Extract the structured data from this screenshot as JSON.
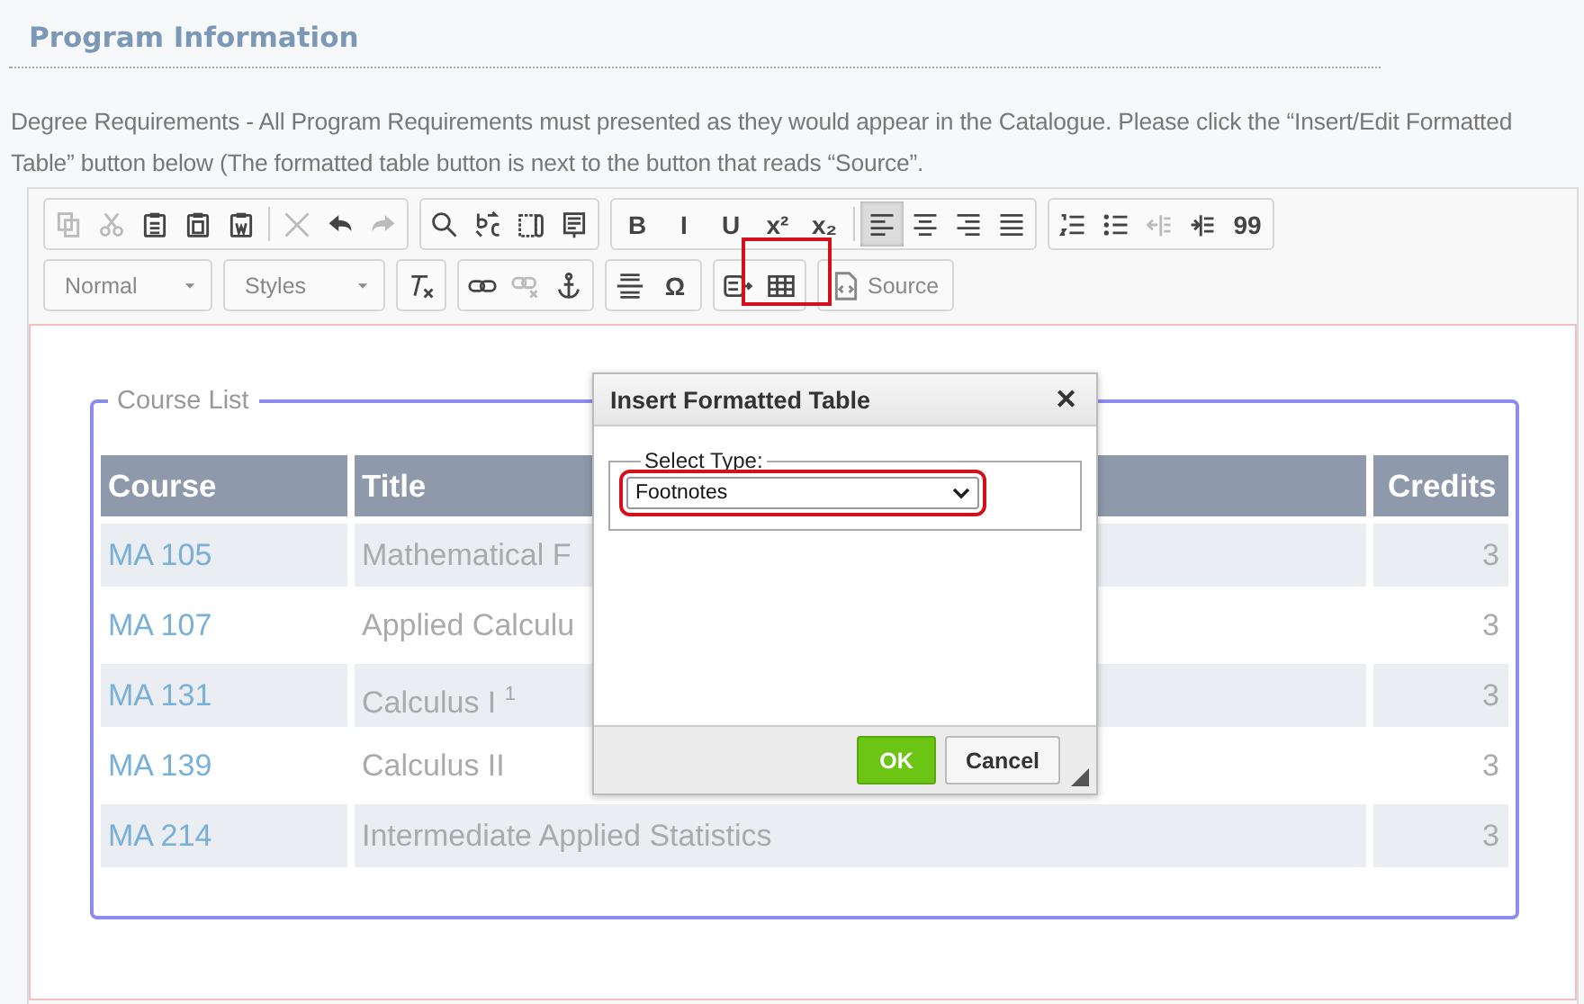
{
  "section_title": "Program Information",
  "instructions": "Degree Requirements - All Program Requirements must presented as they would appear in the Catalogue. Please click the “Insert/Edit Formatted Table” button below (The formatted table button is next to the button that reads “Source”.",
  "toolbar": {
    "rows": [
      [
        {
          "items": [
            {
              "kind": "icon",
              "disabled": true,
              "active": false
            },
            {
              "kind": "icon",
              "disabled": true,
              "active": false
            },
            {
              "kind": "icon",
              "disabled": false,
              "active": false
            },
            {
              "kind": "icon",
              "disabled": false,
              "active": false
            },
            {
              "kind": "icon",
              "disabled": false,
              "active": false
            },
            {
              "kind": "separator"
            },
            {
              "kind": "icon",
              "disabled": true,
              "active": false
            },
            {
              "kind": "icon",
              "disabled": false,
              "active": false
            },
            {
              "kind": "icon",
              "disabled": true,
              "active": false
            }
          ]
        },
        {
          "items": [
            {
              "kind": "icon",
              "disabled": false,
              "active": false
            },
            {
              "kind": "icon",
              "disabled": false,
              "active": false
            },
            {
              "kind": "icon",
              "disabled": false,
              "active": false
            },
            {
              "kind": "icon",
              "disabled": false,
              "active": false
            }
          ]
        },
        {
          "items": [
            {
              "kind": "glyph",
              "text": "B",
              "disabled": false,
              "active": false
            },
            {
              "kind": "glyph",
              "text": "I",
              "disabled": false,
              "active": false
            },
            {
              "kind": "glyph",
              "text": "U",
              "disabled": false,
              "active": false
            },
            {
              "kind": "glyph",
              "text": "x²",
              "disabled": false,
              "active": false
            },
            {
              "kind": "glyph",
              "text": "x₂",
              "disabled": false,
              "active": false
            },
            {
              "kind": "separator"
            },
            {
              "kind": "icon",
              "disabled": false,
              "active": true
            },
            {
              "kind": "icon",
              "disabled": false,
              "active": false
            },
            {
              "kind": "icon",
              "disabled": false,
              "active": false
            },
            {
              "kind": "icon",
              "disabled": false,
              "active": false
            }
          ]
        },
        {
          "items": [
            {
              "kind": "icon",
              "disabled": false,
              "active": false
            },
            {
              "kind": "icon",
              "disabled": false,
              "active": false
            },
            {
              "kind": "icon",
              "disabled": true,
              "active": false
            },
            {
              "kind": "icon",
              "disabled": false,
              "active": false
            },
            {
              "kind": "glyph",
              "text": "99",
              "disabled": false,
              "active": false
            }
          ]
        }
      ],
      [
        {
          "items": [
            {
              "kind": "dropdown",
              "text": "Normal"
            }
          ]
        },
        {
          "items": [
            {
              "kind": "dropdown",
              "text": "Styles"
            }
          ]
        },
        {
          "items": [
            {
              "kind": "icon",
              "disabled": false,
              "active": false
            }
          ]
        },
        {
          "items": [
            {
              "kind": "icon",
              "disabled": false,
              "active": false
            },
            {
              "kind": "icon",
              "disabled": true,
              "active": false
            },
            {
              "kind": "icon",
              "disabled": false,
              "active": false
            }
          ]
        },
        {
          "items": [
            {
              "kind": "icon",
              "disabled": false,
              "active": false
            },
            {
              "kind": "glyph",
              "text": "Ω",
              "disabled": false,
              "active": false
            }
          ]
        },
        {
          "items": [
            {
              "kind": "icon",
              "disabled": false,
              "active": false
            },
            {
              "kind": "icon",
              "disabled": false,
              "active": false,
              "highlighted": true
            }
          ]
        },
        {
          "items": [
            {
              "kind": "labeled",
              "text": "Source",
              "disabled": false,
              "active": false
            }
          ]
        }
      ]
    ]
  },
  "course_list": {
    "legend": "Course List",
    "columns": [
      "Course",
      "Title",
      "Credits"
    ],
    "rows": [
      {
        "course": "MA 105",
        "title": "Mathematical F",
        "credits": "3"
      },
      {
        "course": "MA 107",
        "title": "Applied Calculu",
        "credits": "3"
      },
      {
        "course": "MA 131",
        "title": "Calculus I $^{1}$",
        "credits": "3"
      },
      {
        "course": "MA 139",
        "title": "Calculus II",
        "credits": "3"
      },
      {
        "course": "MA 214",
        "title": "Intermediate Applied Statistics",
        "credits": "3"
      }
    ]
  },
  "dialog": {
    "title": "Insert Formatted Table",
    "close": "✕",
    "fieldset_label": "Select Type:",
    "select_value": "Footnotes",
    "select_highlighted": true,
    "buttons": [
      {
        "label": "OK",
        "kind": "primary"
      },
      {
        "label": "Cancel",
        "kind": "secondary"
      }
    ]
  }
}
